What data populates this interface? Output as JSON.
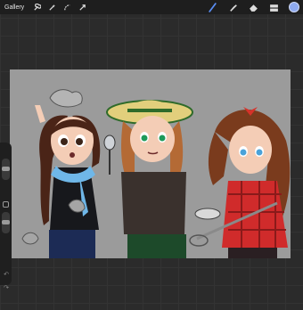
{
  "topbar": {
    "gallery_label": "Gallery",
    "left_tools": [
      "wrench-icon",
      "magic-wand-icon",
      "selection-icon",
      "transform-arrow-icon"
    ],
    "right_tools": [
      "brush-icon",
      "smudge-icon",
      "eraser-icon",
      "layers-icon"
    ],
    "active_tool": "brush-icon",
    "current_color": "#8ea9ee"
  },
  "sidebar": {
    "brush_size": 0.5,
    "brush_opacity": 0.5,
    "undo_icon": "undo-icon",
    "redo_icon": "redo-icon"
  }
}
